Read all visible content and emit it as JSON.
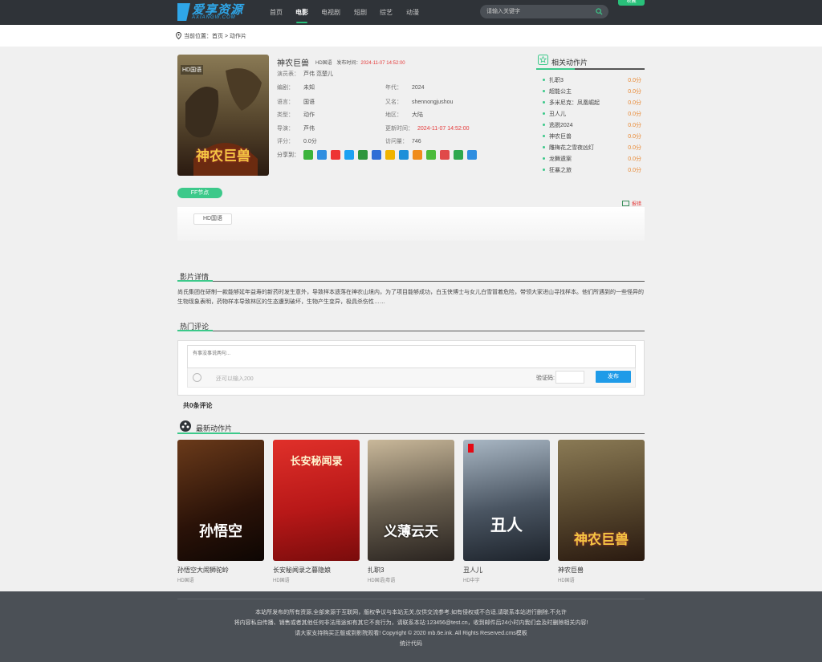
{
  "header": {
    "logo_title": "爱享资源",
    "logo_sub": "AXIANGW.COM",
    "nav": [
      "首页",
      "电影",
      "电视剧",
      "短剧",
      "综艺",
      "动漫"
    ],
    "nav_active_index": 1,
    "search_placeholder": "请输入关键字",
    "collect_label": "收藏"
  },
  "breadcrumb": {
    "label": "当前位置：",
    "home": "首页",
    "sep": ">",
    "current": "动作片"
  },
  "movie": {
    "title": "神农巨兽",
    "quality": "HD国语",
    "release_label": "发布时间：",
    "release": "2024-11-07 14:52:00",
    "poster_badge": "HD国语",
    "poster_title": "神农巨兽",
    "actors_label": "演员表：",
    "actors": "芦伟 范楚儿",
    "fields": [
      {
        "k": "编剧：",
        "v": "未知"
      },
      {
        "k": "年代：",
        "v": "2024"
      },
      {
        "k": "语言：",
        "v": "国语"
      },
      {
        "k": "又名：",
        "v": "shennongjushou"
      },
      {
        "k": "类型：",
        "v": "动作"
      },
      {
        "k": "地区：",
        "v": "大陆"
      },
      {
        "k": "导演：",
        "v": "芦伟"
      },
      {
        "k": "更新时间：",
        "v": "2024-11-07 14:52:00"
      },
      {
        "k": "评分：",
        "v": "0.0分"
      },
      {
        "k": "访问量：",
        "v": "746"
      }
    ],
    "share_label": "分享到：",
    "share_icons": [
      "wechat-icon",
      "qq-icon",
      "weibo-icon",
      "renren-icon",
      "douban-icon",
      "qzone-icon",
      "star-icon",
      "pinterest-icon",
      "shine-icon",
      "pengyou-icon",
      "heart-icon",
      "clover-icon",
      "plus-icon"
    ],
    "share_colors": [
      "#3bb33b",
      "#2f8ee0",
      "#e33",
      "#1da1f2",
      "#2e963d",
      "#2f6ed6",
      "#f0b400",
      "#1c8fd9",
      "#f08c1a",
      "#4cbb3b",
      "#e04a4a",
      "#2ea84e",
      "#2f8ee0"
    ],
    "ff_label": "FF节点",
    "play_chip": "HD国语",
    "report_label": "报错"
  },
  "related": {
    "title": "相关动作片",
    "items": [
      {
        "name": "扎职3",
        "score": "0.0分"
      },
      {
        "name": "超能公主",
        "score": "0.0分"
      },
      {
        "name": "多米尼克：凤凰崛起",
        "score": "0.0分"
      },
      {
        "name": "丑人儿",
        "score": "0.0分"
      },
      {
        "name": "逃脱2024",
        "score": "0.0分"
      },
      {
        "name": "神农巨兽",
        "score": "0.0分"
      },
      {
        "name": "雕梅花之雪夜凶灯",
        "score": "0.0分"
      },
      {
        "name": "龙舞遗案",
        "score": "0.0分"
      },
      {
        "name": "狂暴之旅",
        "score": "0.0分"
      }
    ]
  },
  "details": {
    "title": "影片详情",
    "text": "尚氏集团在研制一款能够延年益寿的新药时发生意外，导致样本遗落在神农山境内，为了项目能够成功，白玉侠博士与女儿白雪冒着危险，带领大家进山寻找样本。他们所遇到的一些怪异的生物现象表明，药物样本导致林区的生态遭到破坏，生物产生变异，极具杀伤性……"
  },
  "comments": {
    "title": "热门评论",
    "placeholder": "有事没事说两句...",
    "count_hint": "还可以输入200",
    "vcode_label": "验证码:",
    "publish_label": "发布",
    "total": "共0条评论"
  },
  "latest": {
    "title": "最新动作片",
    "cards": [
      {
        "name": "孙悟空大闹狮驼岭",
        "tag": "HD国语",
        "poster": "孙悟空"
      },
      {
        "name": "长安秘闻录之暮隐娘",
        "tag": "HD国语",
        "poster": "长安秘闻录"
      },
      {
        "name": "扎职3",
        "tag": "HD国语|粤语",
        "poster": "义薄云天"
      },
      {
        "name": "丑人儿",
        "tag": "HD中字",
        "poster": "丑人"
      },
      {
        "name": "神农巨兽",
        "tag": "HD国语",
        "poster": "神农巨兽"
      }
    ]
  },
  "footer": {
    "line1": "本站所发布的所有资源,全部来源于互联网，版权争议与本站无关,仅供交流参考.如有侵权或不合适,请联系本站进行删除.不允许",
    "line2": "将内容私自传播、销售或者其他任何非法用途如有其它不良行为，请联系本站:123456@test.cn，收到邮件后24小时内我们会及时删除相关内容!",
    "line3": "请大家支持购买正版或到影院观看! Copyright © 2020 mb.6e.ink. All Rights Reserved.cms模板",
    "line4": "统计代码"
  }
}
